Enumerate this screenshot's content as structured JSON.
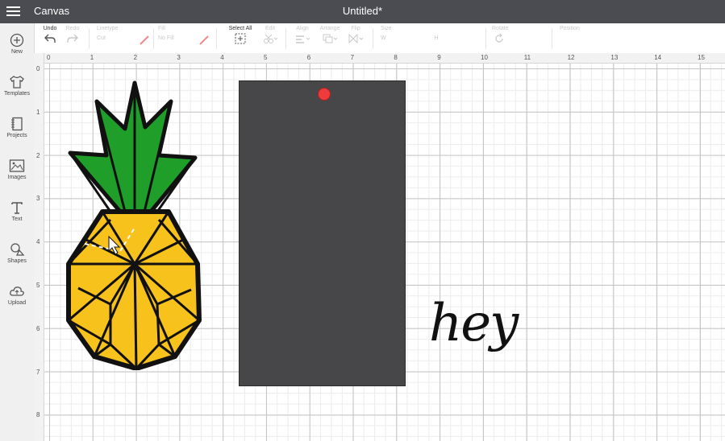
{
  "header": {
    "app_title": "Canvas",
    "doc_title": "Untitled*"
  },
  "toolbar": {
    "undo": "Undo",
    "redo": "Redo",
    "linetype": "Linetype",
    "linetype_value": "Cut",
    "fill": "Fill",
    "fill_value": "No Fill",
    "select_all": "Select All",
    "edit": "Edit",
    "align": "Align",
    "arrange": "Arrange",
    "flip": "Flip",
    "size": "Size",
    "size_w": "W",
    "size_h": "H",
    "rotate": "Rotate",
    "position": "Position"
  },
  "sidebar": {
    "items": [
      {
        "label": "New",
        "icon": "plus-circle-icon"
      },
      {
        "label": "Templates",
        "icon": "tshirt-icon"
      },
      {
        "label": "Projects",
        "icon": "notebook-icon"
      },
      {
        "label": "Images",
        "icon": "image-icon"
      },
      {
        "label": "Text",
        "icon": "text-t-icon"
      },
      {
        "label": "Shapes",
        "icon": "shapes-icon"
      },
      {
        "label": "Upload",
        "icon": "cloud-upload-icon"
      }
    ]
  },
  "canvas": {
    "ruler_h": [
      "0",
      "1",
      "2",
      "3",
      "4",
      "5",
      "6",
      "7",
      "8",
      "9",
      "10",
      "11",
      "12",
      "13",
      "14",
      "15"
    ],
    "ruler_v": [
      "0",
      "1",
      "2",
      "3",
      "4",
      "5",
      "6",
      "7",
      "8"
    ],
    "text_object": "hey",
    "colors": {
      "tag": "#47474a",
      "hole": "#ee3b3b",
      "leaves": "#1f9e2a",
      "fruit": "#f7c21b"
    }
  }
}
